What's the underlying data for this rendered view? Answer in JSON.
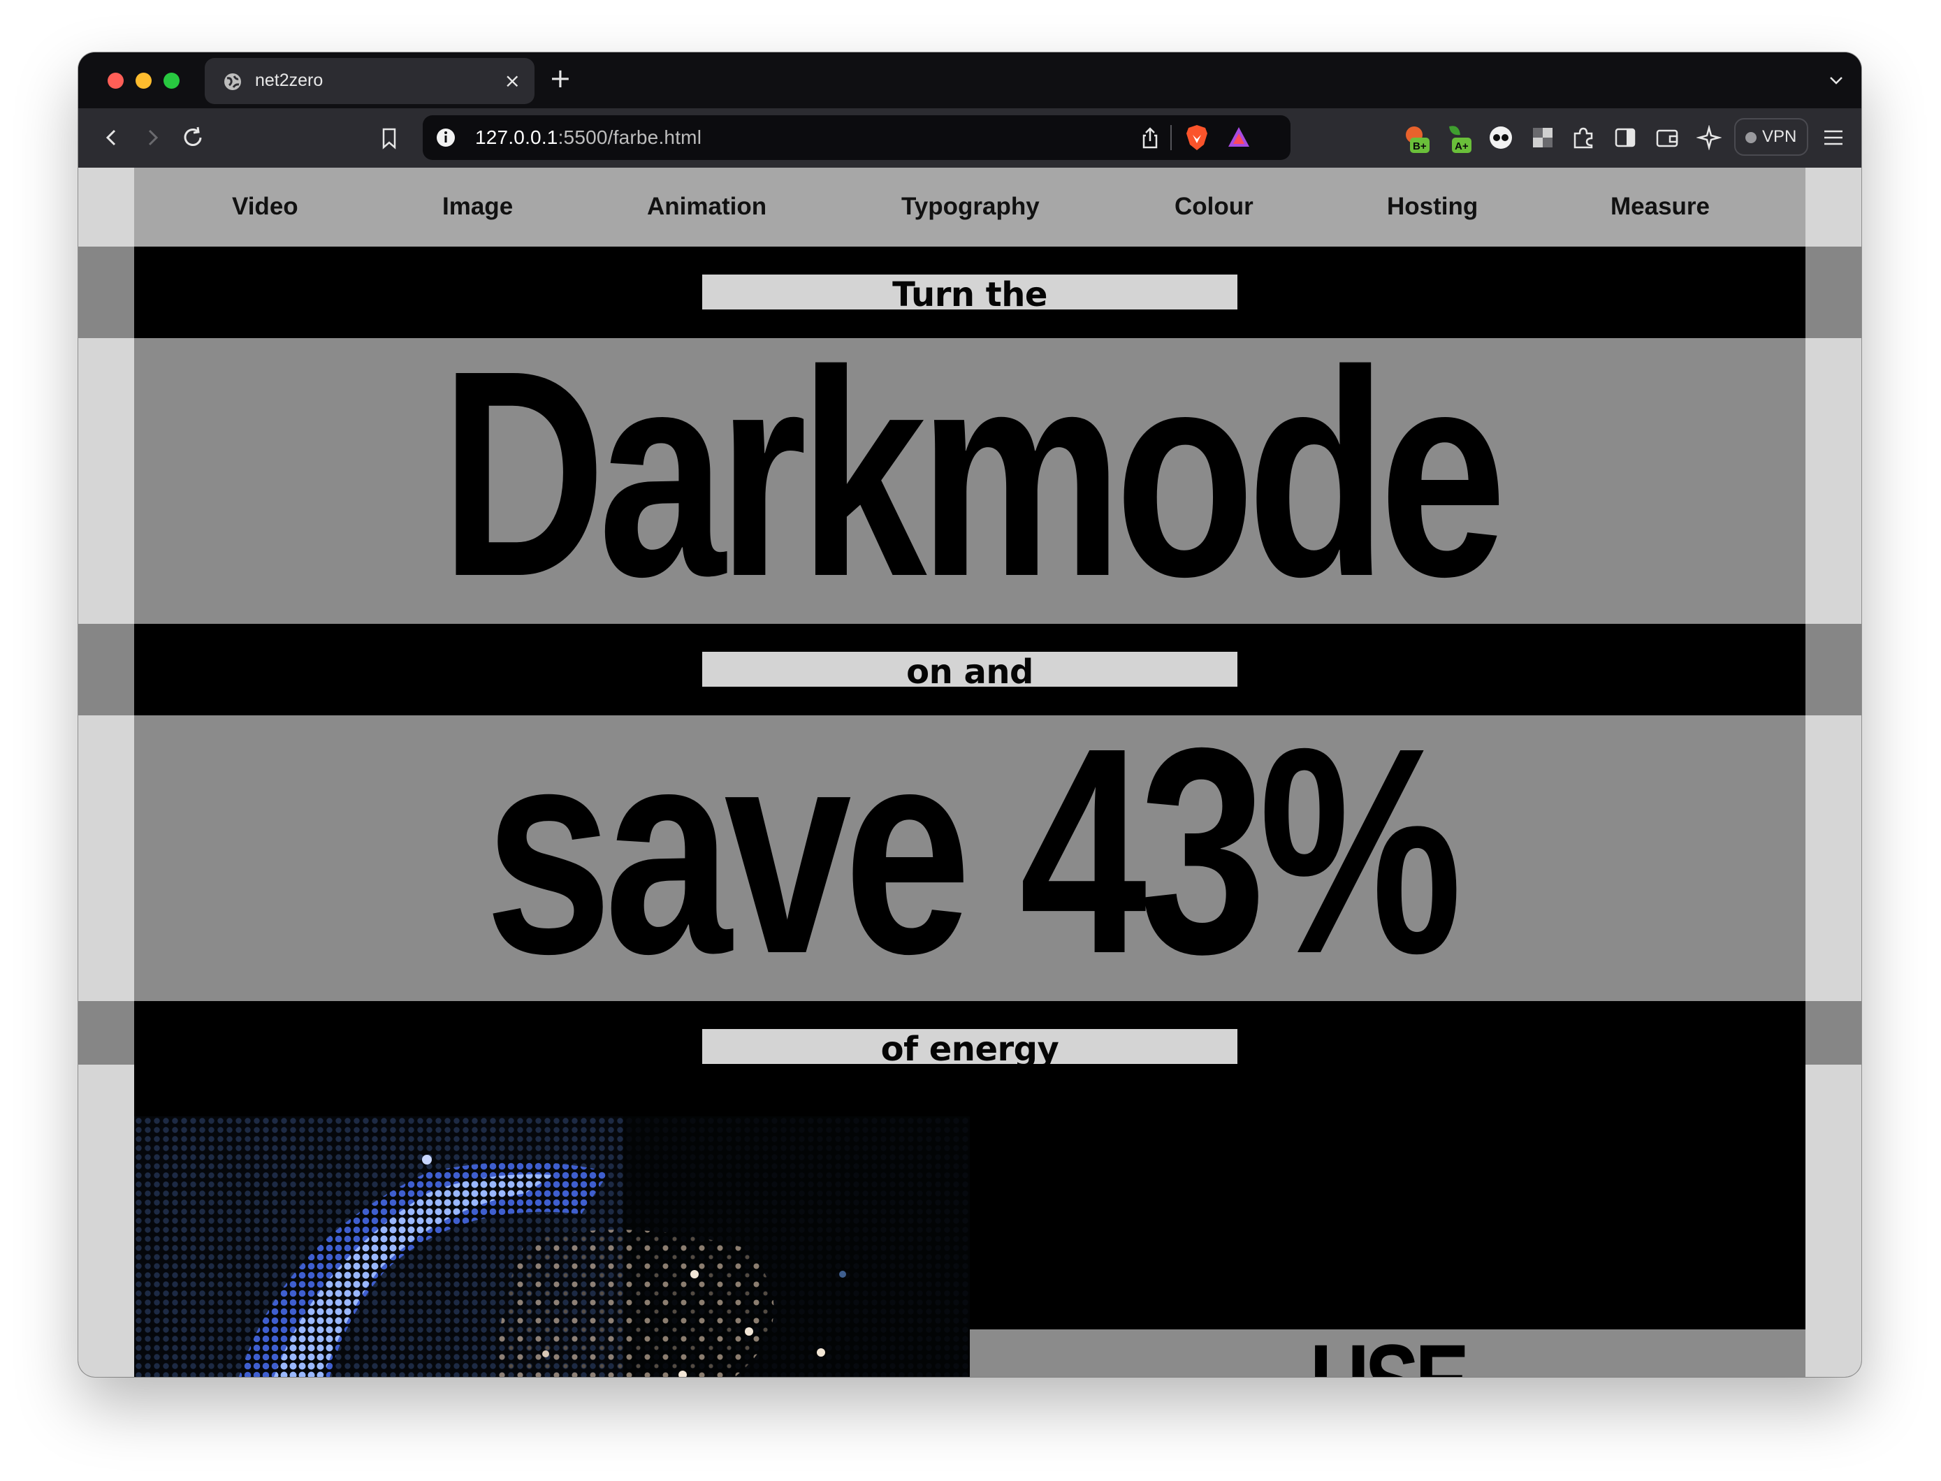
{
  "browser": {
    "tab": {
      "title": "net2zero",
      "close": "×"
    },
    "new_tab": "+",
    "url": {
      "host": "127.0.0.1",
      "rest": ":5500/farbe.html"
    },
    "extensions": {
      "badge1": "B+",
      "badge2": "A+"
    },
    "vpn_label": "VPN",
    "colors": {
      "close": "#ff5f57",
      "minimize": "#febc2e",
      "zoom": "#28c840",
      "brave": "#fb542b"
    }
  },
  "nav": {
    "items": [
      "Video",
      "Image",
      "Animation",
      "Typography",
      "Colour",
      "Hosting",
      "Measure"
    ]
  },
  "hero": {
    "line1": "Turn the",
    "word1": "Darkmode",
    "line2": "on and",
    "word2": "save 43%",
    "line3": "of energy",
    "use": "USE"
  }
}
